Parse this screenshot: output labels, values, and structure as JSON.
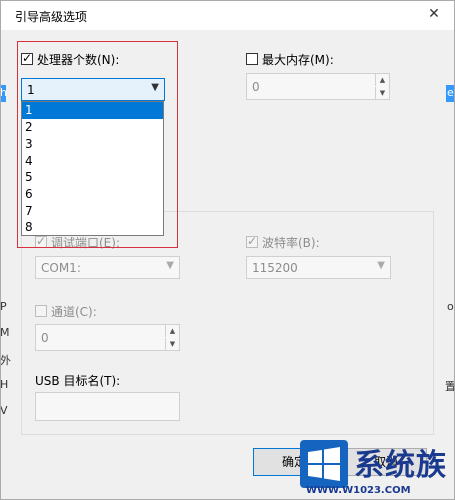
{
  "window": {
    "title": "引导高级选项",
    "close_glyph": "✕"
  },
  "processor": {
    "checkbox_label": "处理器个数(N):",
    "checked": true,
    "selected": "1",
    "options": [
      "1",
      "2",
      "3",
      "4",
      "5",
      "6",
      "7",
      "8"
    ]
  },
  "memory": {
    "checkbox_label": "最大内存(M):",
    "checked": false,
    "value": "0"
  },
  "debug_port": {
    "checkbox_label": "调试端口(E):",
    "checked": true,
    "value": "COM1:"
  },
  "baud_rate": {
    "checkbox_label": "波特率(B):",
    "checked": true,
    "value": "115200"
  },
  "channel": {
    "checkbox_label": "通道(C):",
    "checked": false,
    "value": "0"
  },
  "usb_target": {
    "label": "USB 目标名(T):",
    "value": ""
  },
  "buttons": {
    "ok": "确定",
    "cancel": "取消"
  },
  "watermark": {
    "brand_text": "系统族",
    "url": "WWW.W1023.COM"
  },
  "background_fragments": [
    "h",
    "e",
    "P",
    "M",
    "外",
    "H",
    "V",
    "o",
    "置"
  ],
  "colors": {
    "accent": "#0078d7",
    "highlight_border": "#d9303e",
    "disabled_text": "#8d8d8d"
  }
}
